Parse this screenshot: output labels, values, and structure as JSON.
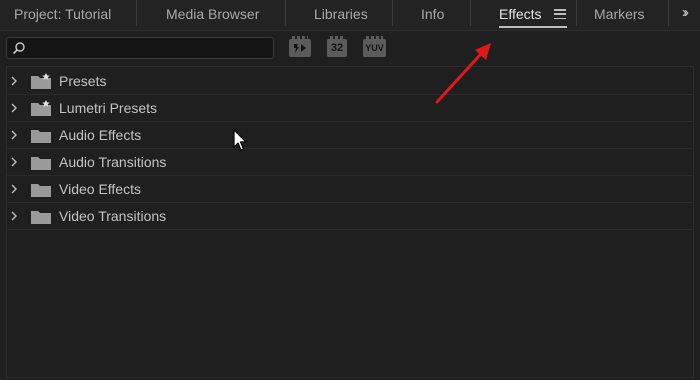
{
  "tabs": [
    {
      "label": "Project: Tutorial",
      "active": false
    },
    {
      "label": "Media Browser",
      "active": false
    },
    {
      "label": "Libraries",
      "active": false
    },
    {
      "label": "Info",
      "active": false
    },
    {
      "label": "Effects",
      "active": true
    },
    {
      "label": "Markers",
      "active": false
    }
  ],
  "toolbar": {
    "search_value": "",
    "search_placeholder": "",
    "buttons": [
      {
        "label": "",
        "icon": "accelerated-effects-icon"
      },
      {
        "label": "32",
        "icon": "32-bit-effects-icon"
      },
      {
        "label": "YUV",
        "icon": "yuv-effects-icon"
      }
    ]
  },
  "effects": [
    {
      "label": "Presets",
      "icon": "starred-folder-icon"
    },
    {
      "label": "Lumetri Presets",
      "icon": "starred-folder-icon"
    },
    {
      "label": "Audio Effects",
      "icon": "folder-icon"
    },
    {
      "label": "Audio Transitions",
      "icon": "folder-icon"
    },
    {
      "label": "Video Effects",
      "icon": "folder-icon"
    },
    {
      "label": "Video Transitions",
      "icon": "folder-icon"
    }
  ],
  "colors": {
    "background": "#1f1f1f",
    "annotation_arrow": "#e01818"
  }
}
